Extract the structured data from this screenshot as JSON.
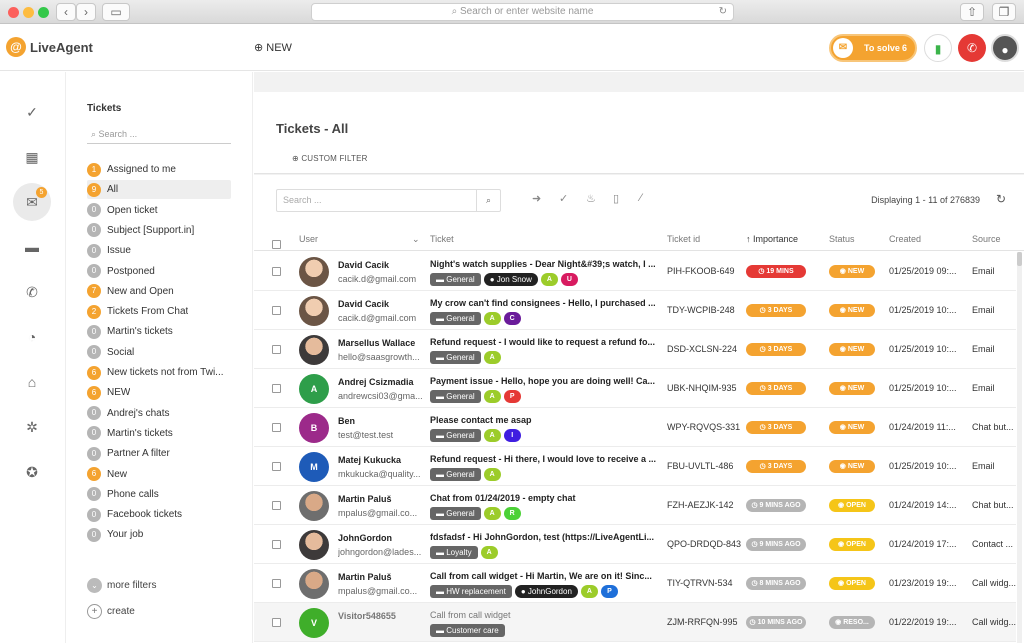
{
  "browser": {
    "url_placeholder": "Search or enter website name"
  },
  "header": {
    "logo": "LiveAgent",
    "new_label": "NEW",
    "to_solve_label": "To solve",
    "to_solve_count": "6"
  },
  "rail": {
    "tickets_badge": "5"
  },
  "sidebar": {
    "title": "Tickets",
    "search_placeholder": "Search ...",
    "items": [
      {
        "count": "1",
        "label": "Assigned to me",
        "color": "orange"
      },
      {
        "count": "9",
        "label": "All",
        "color": "orange",
        "active": true
      },
      {
        "count": "0",
        "label": "Open ticket",
        "color": "grey"
      },
      {
        "count": "0",
        "label": "Subject [Support.in]",
        "color": "grey"
      },
      {
        "count": "0",
        "label": "Issue",
        "color": "grey"
      },
      {
        "count": "0",
        "label": "Postponed",
        "color": "grey"
      },
      {
        "count": "7",
        "label": "New and Open",
        "color": "orange"
      },
      {
        "count": "2",
        "label": "Tickets From Chat",
        "color": "orange"
      },
      {
        "count": "0",
        "label": "Martin's tickets",
        "color": "grey"
      },
      {
        "count": "0",
        "label": "Social",
        "color": "grey"
      },
      {
        "count": "6",
        "label": "New tickets not from Twi...",
        "color": "orange"
      },
      {
        "count": "6",
        "label": "NEW",
        "color": "orange"
      },
      {
        "count": "0",
        "label": "Andrej's chats",
        "color": "grey"
      },
      {
        "count": "0",
        "label": "Martin's tickets",
        "color": "grey"
      },
      {
        "count": "0",
        "label": "Partner A filter",
        "color": "grey"
      },
      {
        "count": "6",
        "label": "New",
        "color": "orange"
      },
      {
        "count": "0",
        "label": "Phone calls",
        "color": "grey"
      },
      {
        "count": "0",
        "label": "Facebook tickets",
        "color": "grey"
      },
      {
        "count": "0",
        "label": "Your job",
        "color": "grey"
      }
    ],
    "more_filters": "more filters",
    "create": "create"
  },
  "main": {
    "title": "Tickets - All",
    "custom_filter": "CUSTOM FILTER",
    "search_placeholder": "Search ...",
    "displaying": "Displaying 1 - 11 of 276839",
    "columns": {
      "user": "User",
      "ticket": "Ticket",
      "ticket_id": "Ticket id",
      "importance": "↑ Importance",
      "status": "Status",
      "created": "Created",
      "source": "Source"
    }
  },
  "colors": {
    "brand_orange": "#f4a330",
    "status_red": "#e53935",
    "status_open": "#f5c518",
    "muted_grey": "#b5b5b5"
  },
  "tickets": [
    {
      "name": "David Cacik",
      "email": "cacik.d@gmail.com",
      "avatar": "photo",
      "subject": "Night's watch supplies - Dear Night&#39;s watch, I ...",
      "tags": [
        {
          "t": "dept",
          "v": "General"
        },
        {
          "t": "agent",
          "v": "Jon Snow"
        },
        {
          "t": "l",
          "v": "A",
          "c": "#9ccc2a"
        },
        {
          "t": "l",
          "v": "U",
          "c": "#d81b60"
        }
      ],
      "ticket_id": "PIH-FKOOB-649",
      "importance": "19 MINS",
      "imp_color": "#e53935",
      "status": "NEW",
      "st_color": "#f4a330",
      "created": "01/25/2019 09:...",
      "source": "Email"
    },
    {
      "name": "David Cacik",
      "email": "cacik.d@gmail.com",
      "avatar": "photo",
      "subject": "My crow can't find consignees - Hello, I purchased ...",
      "tags": [
        {
          "t": "dept",
          "v": "General"
        },
        {
          "t": "l",
          "v": "A",
          "c": "#9ccc2a"
        },
        {
          "t": "l",
          "v": "C",
          "c": "#6a1b9a"
        }
      ],
      "ticket_id": "TDY-WCPIB-248",
      "importance": "3 DAYS",
      "imp_color": "#f4a330",
      "status": "NEW",
      "st_color": "#f4a330",
      "created": "01/25/2019 10:...",
      "source": "Email"
    },
    {
      "name": "Marsellus Wallace",
      "email": "hello@saasgrowth...",
      "avatar": "photo2",
      "subject": "Refund request - I would like to request a refund fo...",
      "tags": [
        {
          "t": "dept",
          "v": "General"
        },
        {
          "t": "l",
          "v": "A",
          "c": "#9ccc2a"
        }
      ],
      "ticket_id": "DSD-XCLSN-224",
      "importance": "3 DAYS",
      "imp_color": "#f4a330",
      "status": "NEW",
      "st_color": "#f4a330",
      "created": "01/25/2019 10:...",
      "source": "Email"
    },
    {
      "name": "Andrej Csizmadia",
      "email": "andrewcsi03@gma...",
      "avatar": "A",
      "av_color": "#2e9e4a",
      "subject": "Payment issue - Hello, hope you are doing well! Ca...",
      "tags": [
        {
          "t": "dept",
          "v": "General"
        },
        {
          "t": "l",
          "v": "A",
          "c": "#9ccc2a"
        },
        {
          "t": "l",
          "v": "P",
          "c": "#e53935"
        }
      ],
      "ticket_id": "UBK-NHQIM-935",
      "importance": "3 DAYS",
      "imp_color": "#f4a330",
      "status": "NEW",
      "st_color": "#f4a330",
      "created": "01/25/2019 10:...",
      "source": "Email"
    },
    {
      "name": "Ben",
      "email": "test@test.test",
      "avatar": "B",
      "av_color": "#9c2a8a",
      "subject": "Please contact me asap",
      "tags": [
        {
          "t": "dept",
          "v": "General"
        },
        {
          "t": "l",
          "v": "A",
          "c": "#9ccc2a"
        },
        {
          "t": "l",
          "v": "I",
          "c": "#3f1ee0"
        }
      ],
      "ticket_id": "WPY-RQVQS-331",
      "importance": "3 DAYS",
      "imp_color": "#f4a330",
      "status": "NEW",
      "st_color": "#f4a330",
      "created": "01/24/2019 11:...",
      "source": "Chat but..."
    },
    {
      "name": "Matej Kukucka",
      "email": "mkukucka@quality...",
      "avatar": "M",
      "av_color": "#1e5bb8",
      "subject": "Refund request - Hi there, I would love to receive a ...",
      "tags": [
        {
          "t": "dept",
          "v": "General"
        },
        {
          "t": "l",
          "v": "A",
          "c": "#9ccc2a"
        }
      ],
      "ticket_id": "FBU-UVLTL-486",
      "importance": "3 DAYS",
      "imp_color": "#f4a330",
      "status": "NEW",
      "st_color": "#f4a330",
      "created": "01/25/2019 10:...",
      "source": "Email"
    },
    {
      "name": "Martin Paluš",
      "email": "mpalus@gmail.co...",
      "avatar": "photo3",
      "subject": "Chat from 01/24/2019 - empty chat",
      "tags": [
        {
          "t": "dept",
          "v": "General"
        },
        {
          "t": "l",
          "v": "A",
          "c": "#9ccc2a"
        },
        {
          "t": "l",
          "v": "R",
          "c": "#4cd137"
        }
      ],
      "ticket_id": "FZH-AEZJK-142",
      "importance": "9 MINS AGO",
      "imp_color": "#b5b5b5",
      "status": "OPEN",
      "st_color": "#f5c518",
      "created": "01/24/2019 14:...",
      "source": "Chat but..."
    },
    {
      "name": "JohnGordon",
      "email": "johngordon@lades...",
      "avatar": "photo2",
      "subject": "fdsfadsf - Hi JohnGordon, test (https://LiveAgentLi...",
      "tags": [
        {
          "t": "dept",
          "v": "Loyalty"
        },
        {
          "t": "l",
          "v": "A",
          "c": "#9ccc2a"
        }
      ],
      "ticket_id": "QPO-DRDQD-843",
      "importance": "9 MINS AGO",
      "imp_color": "#b5b5b5",
      "status": "OPEN",
      "st_color": "#f5c518",
      "created": "01/24/2019 17:...",
      "source": "Contact ..."
    },
    {
      "name": "Martin Paluš",
      "email": "mpalus@gmail.co...",
      "avatar": "photo3",
      "subject": "Call from call widget - Hi Martin, We are on it! Sinc...",
      "tags": [
        {
          "t": "dept",
          "v": "HW replacement"
        },
        {
          "t": "agent",
          "v": "JohnGordon"
        },
        {
          "t": "l",
          "v": "A",
          "c": "#9ccc2a"
        },
        {
          "t": "l",
          "v": "P",
          "c": "#1e6fd9"
        }
      ],
      "ticket_id": "TIY-QTRVN-534",
      "importance": "8 MINS AGO",
      "imp_color": "#b5b5b5",
      "status": "OPEN",
      "st_color": "#f5c518",
      "created": "01/23/2019 19:...",
      "source": "Call widg..."
    },
    {
      "name": "Visitor548655",
      "email": "",
      "avatar": "V",
      "av_color": "#3fae2a",
      "subject": "Call from call widget",
      "tags": [
        {
          "t": "dept",
          "v": "Customer care"
        }
      ],
      "ticket_id": "ZJM-RRFQN-995",
      "importance": "10 MINS AGO",
      "imp_color": "#b5b5b5",
      "status": "RESO...",
      "st_color": "#b5b5b5",
      "created": "01/22/2019 19:...",
      "source": "Call widg...",
      "dim": true
    }
  ]
}
